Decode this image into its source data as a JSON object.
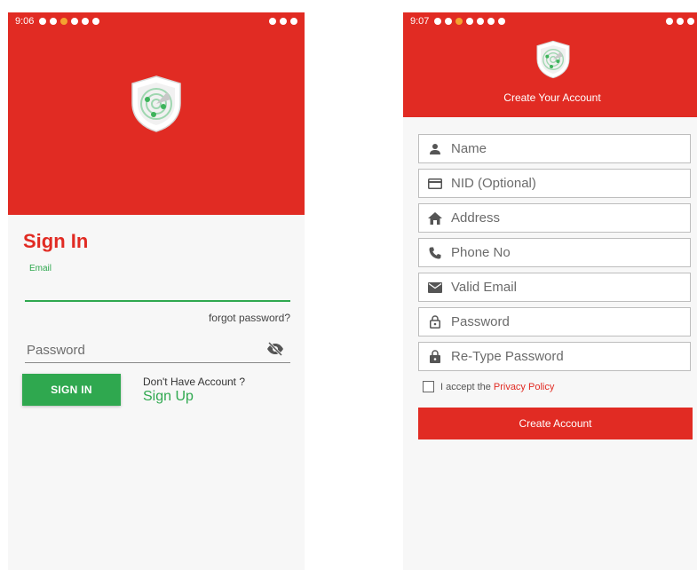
{
  "colors": {
    "brand_red": "#e12b23",
    "accent_green": "#2fa84f",
    "background": "#f7f7f7"
  },
  "signin_screen": {
    "status_time": "9:06",
    "title": "Sign In",
    "email_label": "Email",
    "email_value": "",
    "forgot_password": "forgot password?",
    "password_placeholder": "Password",
    "signin_button": "SIGN IN",
    "no_account_text": "Don't Have Account ?",
    "signup_link": "Sign Up",
    "icons": [
      "shield-radar-logo-icon",
      "eye-off-icon"
    ]
  },
  "signup_screen": {
    "status_time": "9:07",
    "header_title": "Create Your Account",
    "fields": [
      {
        "icon": "person-icon",
        "placeholder": "Name"
      },
      {
        "icon": "id-card-icon",
        "placeholder": "NID (Optional)"
      },
      {
        "icon": "home-icon",
        "placeholder": "Address"
      },
      {
        "icon": "phone-icon",
        "placeholder": "Phone No"
      },
      {
        "icon": "mail-icon",
        "placeholder": "Valid Email"
      },
      {
        "icon": "lock-open-icon",
        "placeholder": "Password"
      },
      {
        "icon": "lock-icon",
        "placeholder": "Re-Type Password"
      }
    ],
    "accept_text": "I accept the",
    "privacy_link": "Privacy Policy",
    "privacy_checked": false,
    "create_button": "Create Account"
  }
}
